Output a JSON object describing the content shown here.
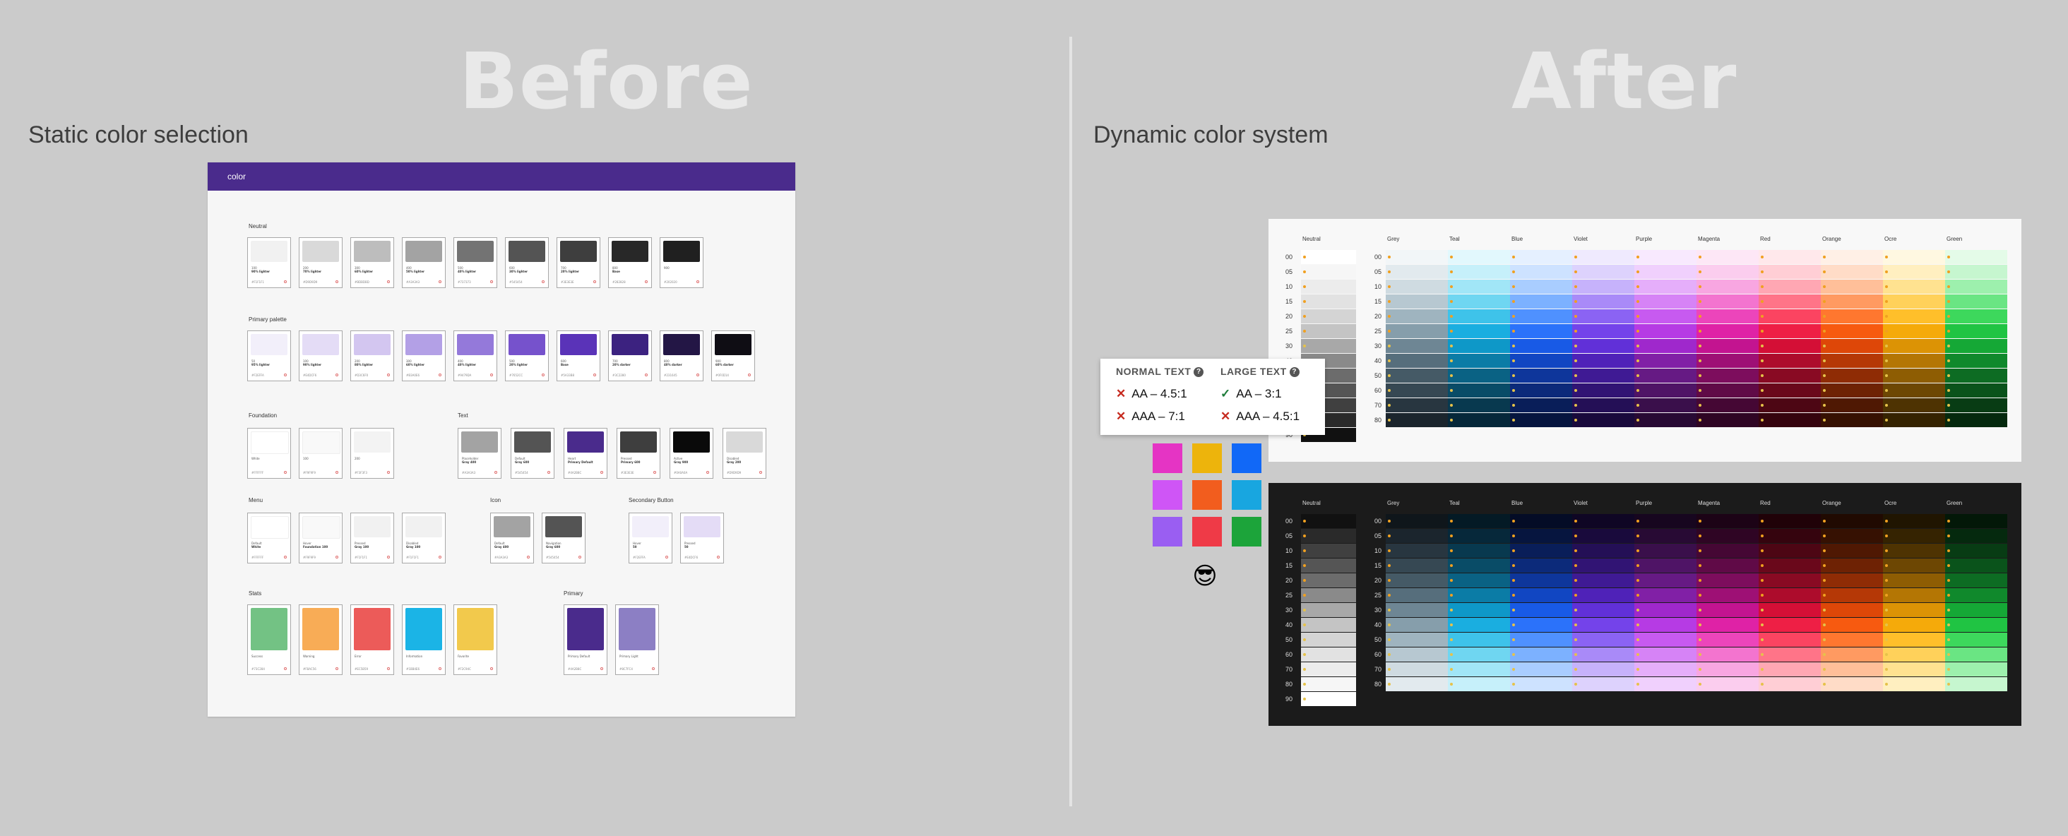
{
  "headings": {
    "before": "Before",
    "after": "After"
  },
  "subtitles": {
    "before": "Static color selection",
    "after": "Dynamic color system"
  },
  "before_card": {
    "header": "color",
    "sections": {
      "neutral": "Neutral",
      "primary_palette": "Primary palette",
      "foundation": "Foundation",
      "text": "Text",
      "menu": "Menu",
      "icon": "Icon",
      "secondary_button": "Secondary Button",
      "stats": "Stats",
      "primary": "Primary"
    },
    "neutral": [
      {
        "c": "#f1f1f1",
        "n": "100",
        "l": "90% lighter",
        "h": "#F1F1F1"
      },
      {
        "c": "#d9d9d9",
        "n": "200",
        "l": "70% lighter",
        "h": "#D9D9D9"
      },
      {
        "c": "#bdbdbd",
        "n": "300",
        "l": "60% lighter",
        "h": "#BDBDBD"
      },
      {
        "c": "#a3a3a3",
        "n": "400",
        "l": "50% lighter",
        "h": "#A3A3A3"
      },
      {
        "c": "#737373",
        "n": "500",
        "l": "40% lighter",
        "h": "#737373"
      },
      {
        "c": "#545454",
        "n": "600",
        "l": "30% lighter",
        "h": "#545454"
      },
      {
        "c": "#3e3e3e",
        "n": "700",
        "l": "20% lighter",
        "h": "#3E3E3E"
      },
      {
        "c": "#282828",
        "n": "800",
        "l": "Base",
        "h": "#282828"
      },
      {
        "c": "#202020",
        "n": "900",
        "l": "",
        "h": "#202020"
      }
    ],
    "primary_palette": [
      {
        "c": "#f2effa",
        "n": "50",
        "l": "95% lighter",
        "h": "#F2EFFA"
      },
      {
        "c": "#e4dcf6",
        "n": "100",
        "l": "90% lighter",
        "h": "#E4DCF6"
      },
      {
        "c": "#d3c6f0",
        "n": "200",
        "l": "80% lighter",
        "h": "#D3C6F0"
      },
      {
        "c": "#b3a0e6",
        "n": "300",
        "l": "60% lighter",
        "h": "#B3A0E6"
      },
      {
        "c": "#9479da",
        "n": "400",
        "l": "40% lighter",
        "h": "#9479DA"
      },
      {
        "c": "#7652cc",
        "n": "500",
        "l": "20% lighter",
        "h": "#7652CC"
      },
      {
        "c": "#5a33b8",
        "n": "600",
        "l": "Base",
        "h": "#5A33B8"
      },
      {
        "c": "#3c2280",
        "n": "700",
        "l": "20% darker",
        "h": "#3C2280"
      },
      {
        "c": "#231645",
        "n": "800",
        "l": "40% darker",
        "h": "#231645"
      },
      {
        "c": "#0f0d14",
        "n": "900",
        "l": "60% darker",
        "h": "#0F0D14"
      }
    ],
    "foundation": [
      {
        "c": "#ffffff",
        "n": "White",
        "l": "",
        "h": "#FFFFFF"
      },
      {
        "c": "#f9f9f9",
        "n": "100",
        "l": "",
        "h": "#F9F9F9"
      },
      {
        "c": "#f3f3f3",
        "n": "200",
        "l": "",
        "h": "#F3F3F3"
      }
    ],
    "text": [
      {
        "c": "#a3a3a3",
        "n": "Placeholder",
        "l": "Gray 400",
        "h": "#A3A3A3"
      },
      {
        "c": "#545454",
        "n": "Default",
        "l": "Gray 600",
        "h": "#545454"
      },
      {
        "c": "#4a2b8c",
        "n": "Heart",
        "l": "Primary Default",
        "h": "#4A2B8C"
      },
      {
        "c": "#3e3e3e",
        "n": "Pressed",
        "l": "Primary 600",
        "h": "#3E3E3E"
      },
      {
        "c": "#0a0a0a",
        "n": "Active",
        "l": "Gray 900",
        "h": "#0A0A0A"
      },
      {
        "c": "#d9d9d9",
        "n": "Disabled",
        "l": "Gray 200",
        "h": "#D9D9D9"
      }
    ],
    "menu": [
      {
        "c": "#ffffff",
        "n": "Default",
        "l": "White",
        "h": "#FFFFFF"
      },
      {
        "c": "#f9f9f9",
        "n": "Hover",
        "l": "Foundation 100",
        "h": "#F9F9F9"
      },
      {
        "c": "#f1f1f1",
        "n": "Pressed",
        "l": "Gray 100",
        "h": "#F1F1F1"
      },
      {
        "c": "#f1f1f1",
        "n": "Disabled",
        "l": "Gray 100",
        "h": "#F1F1F1"
      }
    ],
    "icon": [
      {
        "c": "#a3a3a3",
        "n": "Default",
        "l": "Gray 400",
        "h": "#A3A3A3"
      },
      {
        "c": "#545454",
        "n": "Navigation",
        "l": "Gray 600",
        "h": "#545454"
      }
    ],
    "secondary_button": [
      {
        "c": "#f2effa",
        "n": "Hover",
        "l": "50",
        "h": "#F2EFFA"
      },
      {
        "c": "#e4dcf6",
        "n": "Pressed",
        "l": "50",
        "h": "#E4DCF6"
      }
    ],
    "stats": [
      {
        "c": "#73c284",
        "n": "Success",
        "l": "",
        "h": "#73C284"
      },
      {
        "c": "#f8ac56",
        "n": "Warning",
        "l": "",
        "h": "#F8AC56"
      },
      {
        "c": "#ec5b59",
        "n": "Error",
        "l": "",
        "h": "#EC5B59"
      },
      {
        "c": "#1bb4e6",
        "n": "Information",
        "l": "",
        "h": "#1BB4E6"
      },
      {
        "c": "#f2c94c",
        "n": "Favorite",
        "l": "",
        "h": "#F2C94C"
      }
    ],
    "primary": [
      {
        "c": "#4a2b8c",
        "n": "Primary Default",
        "l": "",
        "h": "#4A2B8C"
      },
      {
        "c": "#8c7fc4",
        "n": "Primary Light",
        "l": "",
        "h": "#8C7FC4"
      }
    ]
  },
  "after_tables": {
    "columns": [
      "Neutral",
      "Grey",
      "Teal",
      "Blue",
      "Violet",
      "Purple",
      "Magenta",
      "Red",
      "Orange",
      "Ocre",
      "Green"
    ],
    "rows": [
      "00",
      "05",
      "10",
      "15",
      "20",
      "25",
      "30",
      "40",
      "50",
      "60",
      "70",
      "80",
      "90"
    ],
    "neutral_light": [
      "#ffffff",
      "#f6f6f6",
      "#ececec",
      "#e2e2e2",
      "#d4d4d4",
      "#c4c4c4",
      "#a8a8a8",
      "#8a8a8a",
      "#6c6c6c",
      "#555555",
      "#404040",
      "#2a2a2a",
      "#111111"
    ],
    "palettes": {
      "Grey": [
        "#f2f6f8",
        "#e2eaee",
        "#cfdbe1",
        "#b7c8d1",
        "#9fb4bf",
        "#869eab",
        "#6e8694",
        "#566e7c",
        "#455a66",
        "#364853",
        "#283640",
        "#1b252d",
        "#0f161b"
      ],
      "Teal": [
        "#e2f8fd",
        "#c6f0fa",
        "#a1e6f7",
        "#6fd6f1",
        "#3ec3ea",
        "#1aaee0",
        "#0e98c8",
        "#0b7ca6",
        "#0a6284",
        "#094c67",
        "#08394f",
        "#06283a",
        "#041a25"
      ],
      "Blue": [
        "#e5f0ff",
        "#cde2ff",
        "#a9cdff",
        "#7cb1ff",
        "#4f91ff",
        "#2b72fa",
        "#185ae6",
        "#1146c2",
        "#0e369b",
        "#0c2a7a",
        "#091e59",
        "#06153f",
        "#040c26"
      ],
      "Violet": [
        "#efeafe",
        "#ddd2fd",
        "#c6b2fb",
        "#a98af8",
        "#8b63f3",
        "#7443ea",
        "#6130d8",
        "#4f22b8",
        "#3f1a94",
        "#311474",
        "#240f56",
        "#190a3c",
        "#0f0624"
      ],
      "Purple": [
        "#f8e9fe",
        "#f0d0fd",
        "#e5aefa",
        "#d683f6",
        "#c75af0",
        "#b63be4",
        "#9f28cc",
        "#8120a6",
        "#661a84",
        "#4f1466",
        "#3a0f4b",
        "#280a34",
        "#17061f"
      ],
      "Magenta": [
        "#fde7f6",
        "#fbcdee",
        "#f8a6e1",
        "#f374cf",
        "#ec45bb",
        "#df22a6",
        "#c31490",
        "#9e1075",
        "#7d0d5d",
        "#600a47",
        "#450734",
        "#2f0524",
        "#1c0316"
      ],
      "Red": [
        "#ffe8eb",
        "#ffced5",
        "#ffa7b3",
        "#ff7488",
        "#fb4461",
        "#ee1f45",
        "#d40f36",
        "#ad0c2c",
        "#890a23",
        "#6a081b",
        "#4d0614",
        "#35040e",
        "#200208"
      ],
      "Orange": [
        "#fff0e6",
        "#ffdcc7",
        "#ffbf99",
        "#ff9a61",
        "#ff772f",
        "#f75a10",
        "#de4708",
        "#b53806",
        "#8f2c05",
        "#6e2204",
        "#4f1803",
        "#361102",
        "#200a01"
      ],
      "Ocre": [
        "#fff8e1",
        "#ffefc0",
        "#ffe290",
        "#ffd15a",
        "#ffbf2a",
        "#f5aa0a",
        "#dc9305",
        "#b47604",
        "#8e5d03",
        "#6d4703",
        "#4e3302",
        "#352301",
        "#201501"
      ],
      "Green": [
        "#e4fbe8",
        "#c6f6cf",
        "#9df0ad",
        "#6ae583",
        "#3dd85c",
        "#20c443",
        "#15a836",
        "#10892c",
        "#0d6c23",
        "#0a531b",
        "#083c14",
        "#05290e",
        "#031808"
      ]
    }
  },
  "contrast_popup": {
    "normal_title": "NORMAL TEXT",
    "large_title": "LARGE TEXT",
    "help": "?",
    "aa_normal": "AA – 4.5:1",
    "aaa_normal": "AAA – 7:1",
    "aa_large": "AA – 3:1",
    "aaa_large": "AAA – 4.5:1",
    "fail_mark": "✕",
    "pass_mark": "✓"
  },
  "sample_squares": [
    "#e534c4",
    "#edb40c",
    "#1168f7",
    "#cf55f6",
    "#f25d1e",
    "#18a6e0",
    "#9a5ef2",
    "#ef3a47",
    "#1ca43a"
  ],
  "emoji": "😎"
}
